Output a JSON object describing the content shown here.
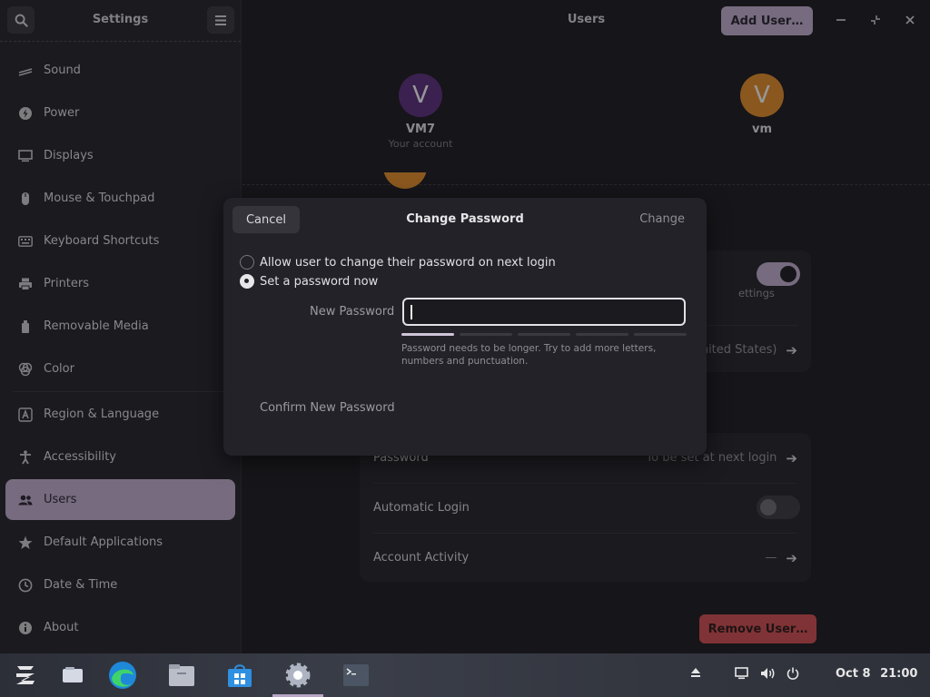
{
  "sidebar": {
    "title": "Settings",
    "search_icon": "search-icon",
    "menu_icon": "hamburger-menu-icon",
    "items": [
      {
        "label": "Sound",
        "icon": "speaker-icon"
      },
      {
        "label": "Power",
        "icon": "power-icon"
      },
      {
        "label": "Displays",
        "icon": "display-icon"
      },
      {
        "label": "Mouse & Touchpad",
        "icon": "mouse-icon"
      },
      {
        "label": "Keyboard Shortcuts",
        "icon": "keyboard-icon"
      },
      {
        "label": "Printers",
        "icon": "printer-icon"
      },
      {
        "label": "Removable Media",
        "icon": "usb-icon"
      },
      {
        "label": "Color",
        "icon": "color-icon"
      },
      {
        "label": "Region & Language",
        "icon": "language-icon"
      },
      {
        "label": "Accessibility",
        "icon": "accessibility-icon"
      },
      {
        "label": "Users",
        "icon": "users-icon",
        "active": true
      },
      {
        "label": "Default Applications",
        "icon": "star-icon"
      },
      {
        "label": "Date & Time",
        "icon": "clock-icon"
      },
      {
        "label": "About",
        "icon": "info-icon"
      }
    ]
  },
  "main": {
    "title": "Users",
    "add_user_label": "Add User…",
    "users": [
      {
        "initial": "V",
        "name": "VM7",
        "subtitle": "Your account",
        "color": "#5a2f7a"
      },
      {
        "initial": "V",
        "name": "vm",
        "subtitle": "",
        "color": "#d9882b"
      }
    ],
    "rows": {
      "language_value": "nited States)",
      "settings_fragment": "ettings",
      "password_label": "Password",
      "password_value": "To be set at next login",
      "auto_login_label": "Automatic Login",
      "account_activity_label": "Account Activity",
      "account_activity_value": "—"
    },
    "remove_user_label": "Remove User…"
  },
  "dialog": {
    "title": "Change Password",
    "cancel_label": "Cancel",
    "change_label": "Change",
    "option_next_login": "Allow user to change their password on next login",
    "option_set_now": "Set a password now",
    "selected_option": "set_now",
    "new_password_label": "New Password",
    "new_password_value": "",
    "strength_level": 0.2,
    "hint": "Password needs to be longer. Try to add more letters, numbers and punctuation.",
    "confirm_label": "Confirm New Password"
  },
  "taskbar": {
    "clock_date": "Oct 8",
    "clock_time": "21:00",
    "apps": [
      "zorin-menu-icon",
      "workspaces-icon",
      "edge-browser-icon",
      "files-icon",
      "software-store-icon",
      "settings-gear-icon",
      "terminal-icon"
    ],
    "tray": [
      "eject-icon",
      "screen-icon",
      "volume-icon",
      "power-icon"
    ]
  },
  "colors": {
    "accent": "#b8a6c6",
    "danger": "#c84d50",
    "sidebar_bg": "#25242a",
    "main_bg": "#1d1c21",
    "dialog_bg": "#232228"
  }
}
